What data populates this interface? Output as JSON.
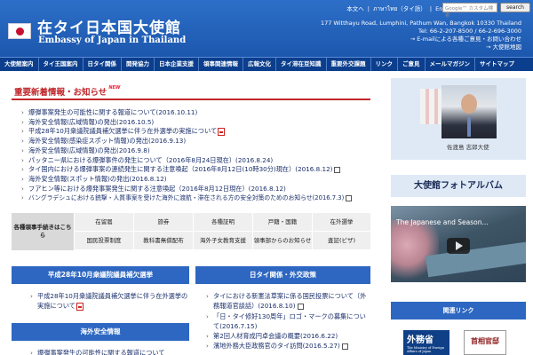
{
  "header": {
    "title_jp": "在タイ日本国大使館",
    "title_en": "Embassy of Japan in Thailand",
    "toplinks": [
      "本文へ",
      "|",
      "ภาษาไทย（タイ語）",
      "|",
      "English(英語)",
      "|"
    ],
    "search_placeholder": "Google™ カスタム検索",
    "search_button": "search",
    "address": [
      "177 Witthayu Road, Lumphini, Pathum Wan, Bangkok 10330 Thailand",
      "Tel: 66-2-207-8500 / 66-2-696-3000",
      "→ E-mailによる各種ご意見・お問い合わせ",
      "→ 大使館地図"
    ]
  },
  "nav": [
    "大使館案内",
    "タイ王国案内",
    "日タイ関係",
    "開発協力",
    "日本企業支援",
    "領事関連情報",
    "広報文化",
    "タイ滞在豆知識",
    "重要外交課題",
    "リンク",
    "ご意見",
    "メールマガジン",
    "サイトマップ"
  ],
  "news": {
    "title": "重要新着情報・お知らせ",
    "badge": "NEW",
    "items": [
      "爆弾事案発生の可能性に関する報道について(2016.10.11)",
      "海外安全情報(広域情報)の発出(2016.10.5)",
      "平成28年10月衆議院議員補欠選挙に伴う在外選挙の実施について",
      "海外安全情報(感染症スポット情報)の発出(2016.9.13)",
      "海外安全情報(広域情報)の発出(2016.9.8)",
      "パッタニー県における爆弾事件の発生について（2016年8月24日現在）(2016.8.24)",
      "タイ国内における爆弾事案の連続発生に関する注意喚起（2016年8月12日(10時30分)現在）(2016.8.12)",
      "海外安全情報(スポット情報)の発出(2016.8.12)",
      "フアヒン等における爆発事案発生に関する注意喚起（2016年8月12日現在）(2016.8.12)",
      "バングラデシュにおける銃撃・人質事案を受けた海外に渡航・滞在される方の安全対策のためのお知らせ(2016.7.3)"
    ]
  },
  "consular": {
    "label": "各種領事手続きはこちら",
    "row1": [
      "在留届",
      "旅券",
      "各種証明",
      "戸籍・国籍",
      "在外選挙"
    ],
    "row2": [
      "国民投票制度",
      "教科書無償配布",
      "海外子女教育支援",
      "領事部からのお知らせ",
      "査証(ビザ)"
    ]
  },
  "box_election": {
    "title": "平成28年10月衆議院議員補欠選挙",
    "items": [
      "平成28年10月衆議院議員補欠選挙に伴う在外選挙の実施について"
    ]
  },
  "box_safety": {
    "title": "海外安全情報",
    "items": [
      "爆弾事案発生の可能性に関する報道について"
    ]
  },
  "box_relations": {
    "title": "日タイ関係・外交政策",
    "items": [
      "タイにおける新憲法草案に係る国民投票について（外務報道官談話）(2016.8.10)",
      "「日・タイ修好130周年」ロゴ・マークの募集について(2016.7.15)",
      "第2回人材育成円卓会議の概要(2016.6.22)",
      "濱地外務大臣政務官のタイ訪問(2016.5.27)"
    ]
  },
  "ambassador": {
    "name": "佐渡島 志郎大使"
  },
  "album": {
    "title": "大使館フォトアルバム"
  },
  "video": {
    "title": "The Japanese and Season..."
  },
  "related": {
    "title": "関連リンク",
    "banner1": "外務省",
    "banner1_sub": "The Ministry of Foreign Affairs of Japan",
    "banner2": "首相官邸"
  },
  "colors": {
    "header_blue": "#1c57ad",
    "nav_blue": "#0b3e8d",
    "accent_red": "#c0282d"
  }
}
